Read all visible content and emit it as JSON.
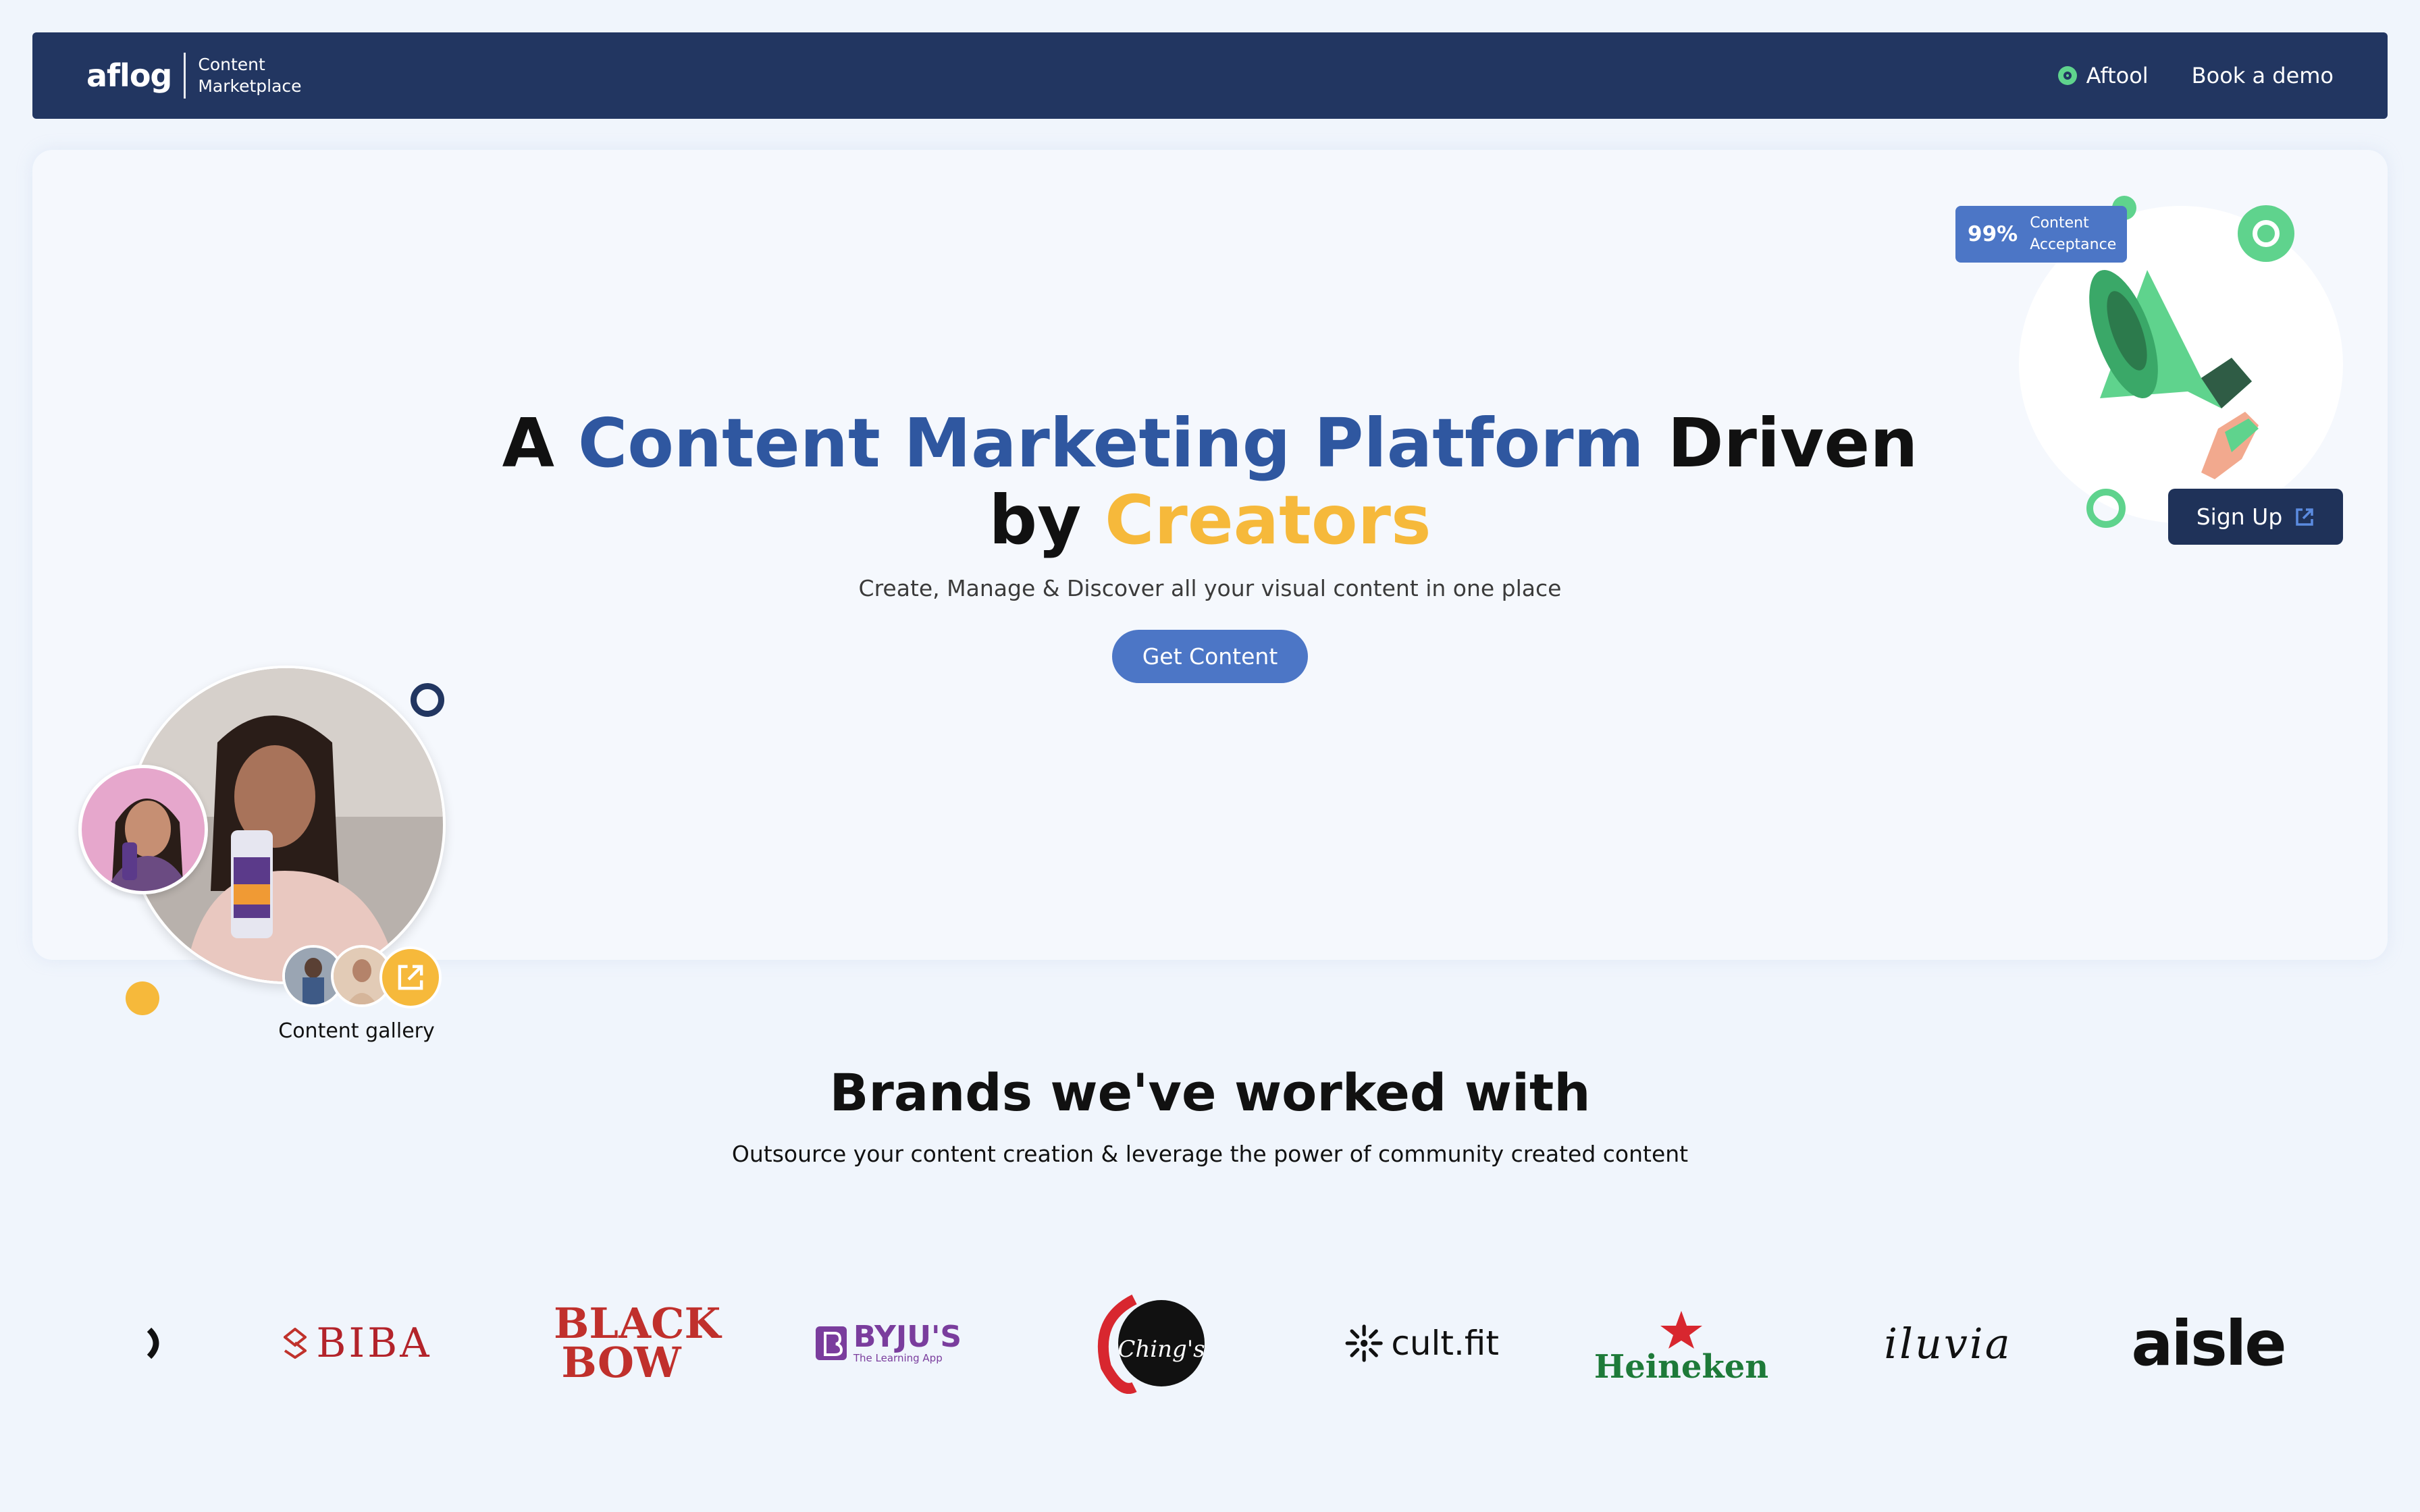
{
  "nav": {
    "logo": "aflog",
    "sub_line1": "Content",
    "sub_line2": "Marketplace",
    "links": [
      {
        "label": "Aftool",
        "icon": "aftool-icon"
      },
      {
        "label": "Book a demo"
      }
    ]
  },
  "hero": {
    "headline_a": "A",
    "headline_blue": "Content Marketing Platform",
    "headline_driven": "Driven",
    "headline_by": "by",
    "headline_creators": "Creators",
    "subtitle": "Create, Manage & Discover all your visual content in one place",
    "cta": "Get Content",
    "stat_value": "99%",
    "stat_label_line1": "Content",
    "stat_label_line2": "Acceptance",
    "signup": "Sign Up",
    "gallery_label": "Content gallery"
  },
  "brands": {
    "title": "Brands we've worked with",
    "subtitle": "Outsource your content creation & leverage the power of community created content",
    "logos": [
      "BIBA",
      "BLACK BOW",
      "BYJU'S",
      "The Learning App",
      "Ching's",
      "cult.fit",
      "Heineken",
      "iluvia",
      "aisle"
    ]
  },
  "colors": {
    "navy": "#223661",
    "accent_blue": "#2f57a0",
    "button_blue": "#4c76c6",
    "yellow": "#f6b93b",
    "green": "#5fd38d"
  }
}
